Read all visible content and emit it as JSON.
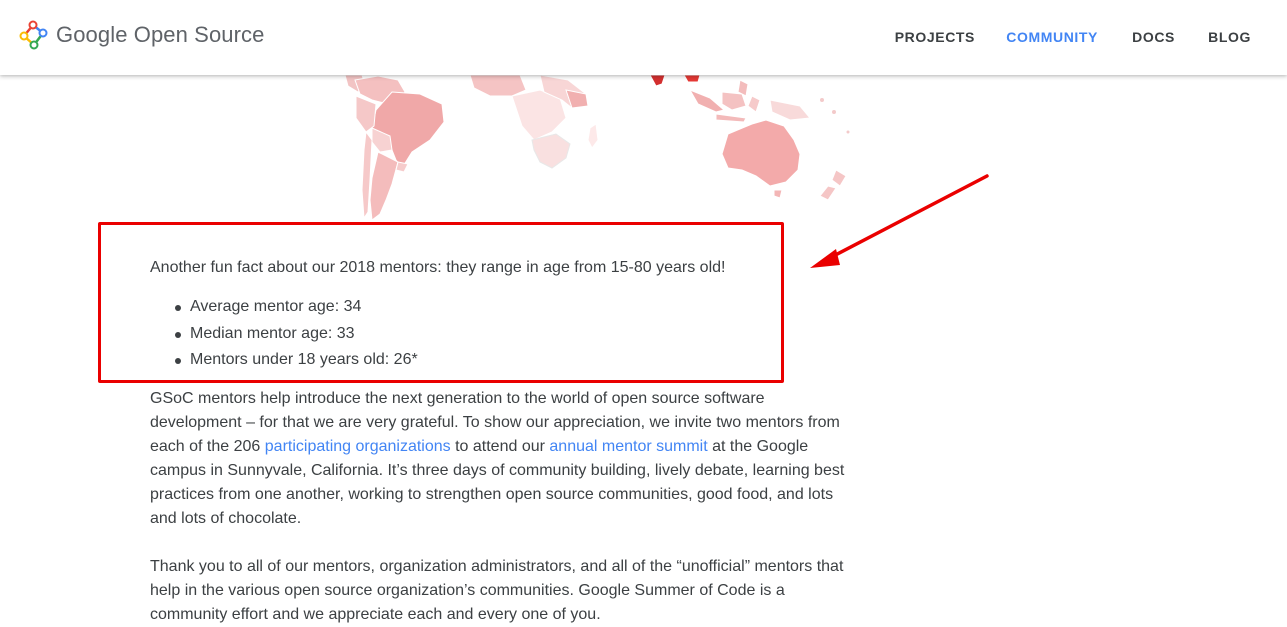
{
  "header": {
    "logo_text": "Google Open Source",
    "nav": [
      {
        "label": "PROJECTS",
        "active": false
      },
      {
        "label": "COMMUNITY",
        "active": true
      },
      {
        "label": "DOCS",
        "active": false
      },
      {
        "label": "BLOG",
        "active": false
      }
    ]
  },
  "map": {
    "icon": "world-map-illustration",
    "fill_color": "#f4b6b6",
    "highlight_color": "#e53935"
  },
  "article": {
    "fun_fact": "Another fun fact about our 2018 mentors: they range in age from 15-80 years old!",
    "stats": [
      "Average mentor age: 34",
      "Median mentor age: 33",
      "Mentors under 18 years old: 26*"
    ],
    "para1": {
      "before_link1": "GSoC mentors help introduce the next generation to the world of open source software development – for that we are very grateful. To show our appreciation, we invite two mentors from each of the 206 ",
      "link1": "participating organizations",
      "between_links": " to attend our ",
      "link2": "annual mentor summit",
      "after_link2": " at the Google campus in Sunnyvale, California. It’s three days of community building, lively debate, learning best practices from one another, working to strengthen open source communities, good food, and lots and lots of chocolate."
    },
    "para2": "Thank you to all of our mentors, organization administrators, and all of the “unofficial” mentors that help in the various open source organization’s communities. Google Summer of Code is a community effort and we appreciate each and every one of you."
  },
  "annotation": {
    "color": "#ea0000"
  }
}
